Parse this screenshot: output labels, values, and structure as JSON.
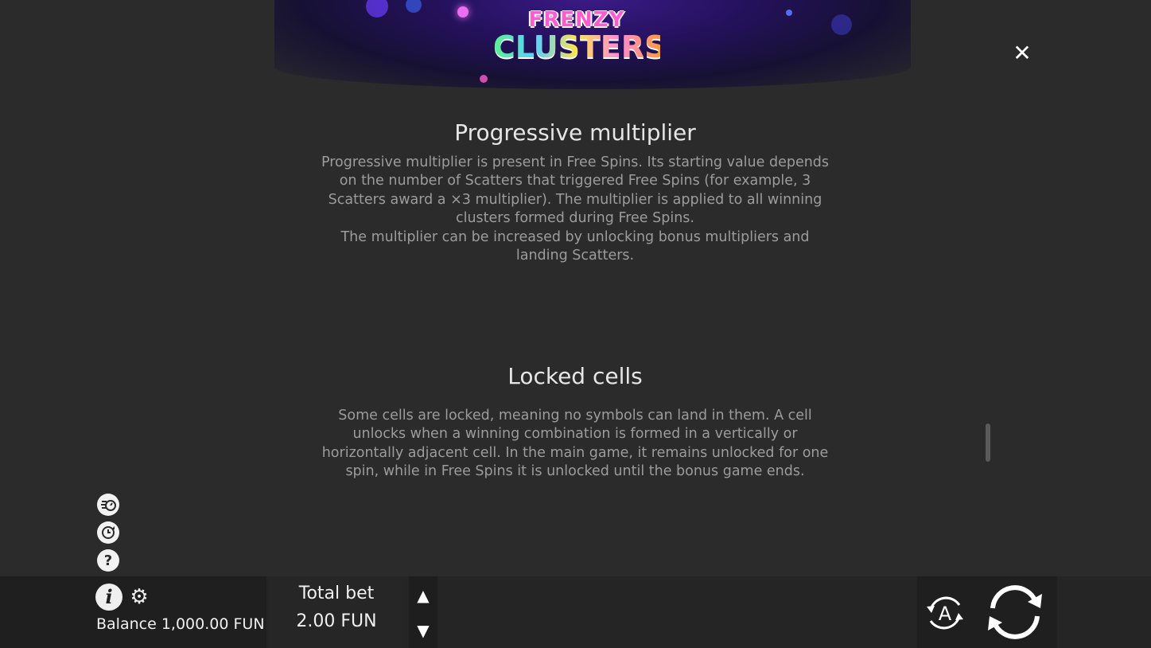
{
  "header": {
    "logo_line1": "FRENZY",
    "logo_line2": "CLUSTERS"
  },
  "rules": {
    "sections": [
      {
        "title": "Progressive multiplier",
        "text": "Progressive multiplier is present in Free Spins. Its starting value depends on the number of Scatters that triggered Free Spins (for example, 3 Scatters award a ×3 multiplier). The multiplier is applied to all winning clusters formed during Free Spins.",
        "text2": "The multiplier can be increased by unlocking bonus multipliers and landing Scatters."
      },
      {
        "title": "Locked cells",
        "text": "Some cells are locked, meaning no symbols can land in them. A cell unlocks when a winning combination is formed in a vertically or horizontally adjacent cell. In the main game, it remains unlocked for one spin, while in Free Spins it is unlocked until the bonus game ends."
      }
    ]
  },
  "close_icon": "close-icon",
  "side_icons": [
    "turbo-icon",
    "history-icon",
    "help-icon"
  ],
  "bottom_bar": {
    "balance_label": "Balance",
    "balance_value": "1,000.00 FUN",
    "bet_label": "Total bet",
    "bet_value": "2.00 FUN",
    "auto_label": "A"
  },
  "colors": {
    "background": "#2b2b2b",
    "heading": "#e6e6e6",
    "body_text": "#9c9c9c",
    "bar": "#1f1f1f"
  }
}
